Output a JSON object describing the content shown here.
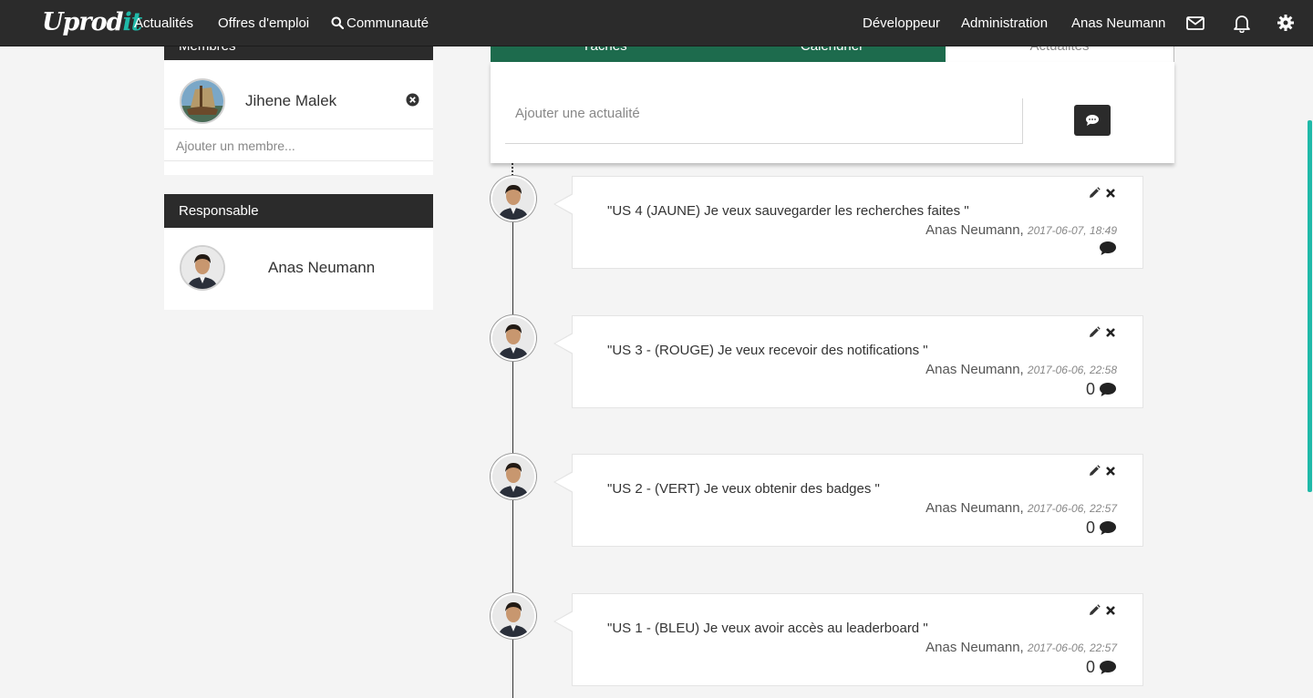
{
  "navbar": {
    "brand_main": "Uprod",
    "brand_accent": "it",
    "links": [
      "Actualités",
      "Offres d'emploi",
      "Communauté"
    ],
    "right_links": [
      "Développeur",
      "Administration",
      "Anas Neumann"
    ],
    "icons": [
      "envelope-icon",
      "bell-icon",
      "gear-icon"
    ]
  },
  "sidebar": {
    "members_title": "Membres",
    "members": [
      {
        "name": "Jihene Malek"
      }
    ],
    "add_member_placeholder": "Ajouter un membre...",
    "responsable_title": "Responsable",
    "responsable": {
      "name": "Anas Neumann"
    }
  },
  "tabs": [
    {
      "label": "Tâches",
      "active": false
    },
    {
      "label": "Calendrier",
      "active": false
    },
    {
      "label": "Actualités",
      "active": true
    }
  ],
  "composer": {
    "placeholder": "Ajouter une actualité"
  },
  "posts": [
    {
      "text": "\"US 4 (JAUNE) Je veux sauvegarder les recherches faites \"",
      "author": "Anas Neumann,",
      "date": "2017-06-07, 18:49",
      "comments": ""
    },
    {
      "text": "\"US 3 - (ROUGE) Je veux recevoir des notifications \"",
      "author": "Anas Neumann,",
      "date": "2017-06-06, 22:58",
      "comments": "0"
    },
    {
      "text": "\"US 2 - (VERT) Je veux obtenir des badges \"",
      "author": "Anas Neumann,",
      "date": "2017-06-06, 22:57",
      "comments": "0"
    },
    {
      "text": "\"US 1 - (BLEU) Je veux avoir accès au leaderboard \"",
      "author": "Anas Neumann,",
      "date": "2017-06-06, 22:57",
      "comments": "0"
    }
  ],
  "colors": {
    "navbar": "#2b2b2b",
    "tab_green": "#1d6b4d",
    "accent": "#1fb9a8",
    "background": "#f4f4f4"
  }
}
